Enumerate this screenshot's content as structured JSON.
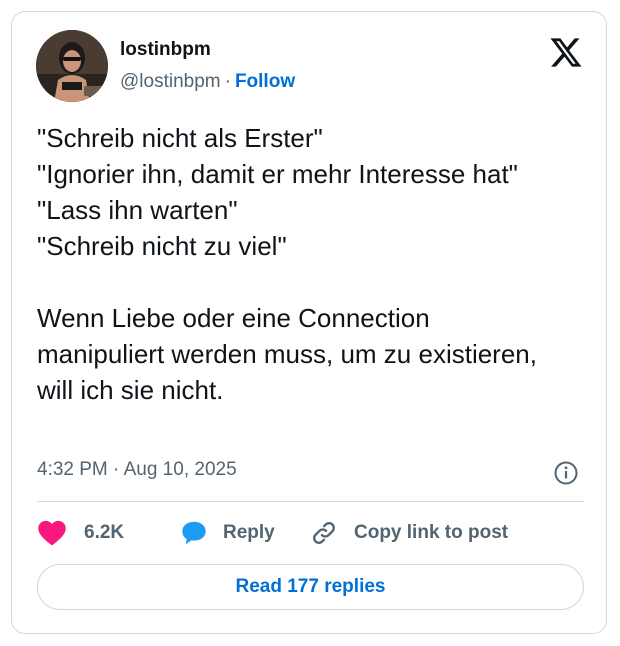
{
  "author": {
    "name": "lostinbpm",
    "handle": "@lostinbpm",
    "separator": "·",
    "follow_label": "Follow"
  },
  "tweet": {
    "text": "\"Schreib nicht als Erster\"\n\"Ignorier ihn, damit er mehr Interesse hat\"\n\"Lass ihn warten\"\n\"Schreib nicht zu viel\"\n\nWenn Liebe oder eine Connection manipuliert werden muss, um zu existieren, will ich sie nicht.",
    "timestamp": "4:32 PM · Aug 10, 2025"
  },
  "actions": {
    "like_count": "6.2K",
    "reply_label": "Reply",
    "copy_label": "Copy link to post"
  },
  "read_replies_label": "Read 177 replies",
  "colors": {
    "like": "#f91880",
    "reply": "#1d9bf0",
    "link": "#006fd6",
    "muted": "#536471"
  },
  "icons": {
    "logo": "x-logo-icon",
    "info": "info-icon",
    "like": "heart-icon",
    "reply": "speech-bubble-icon",
    "copy": "link-icon"
  }
}
